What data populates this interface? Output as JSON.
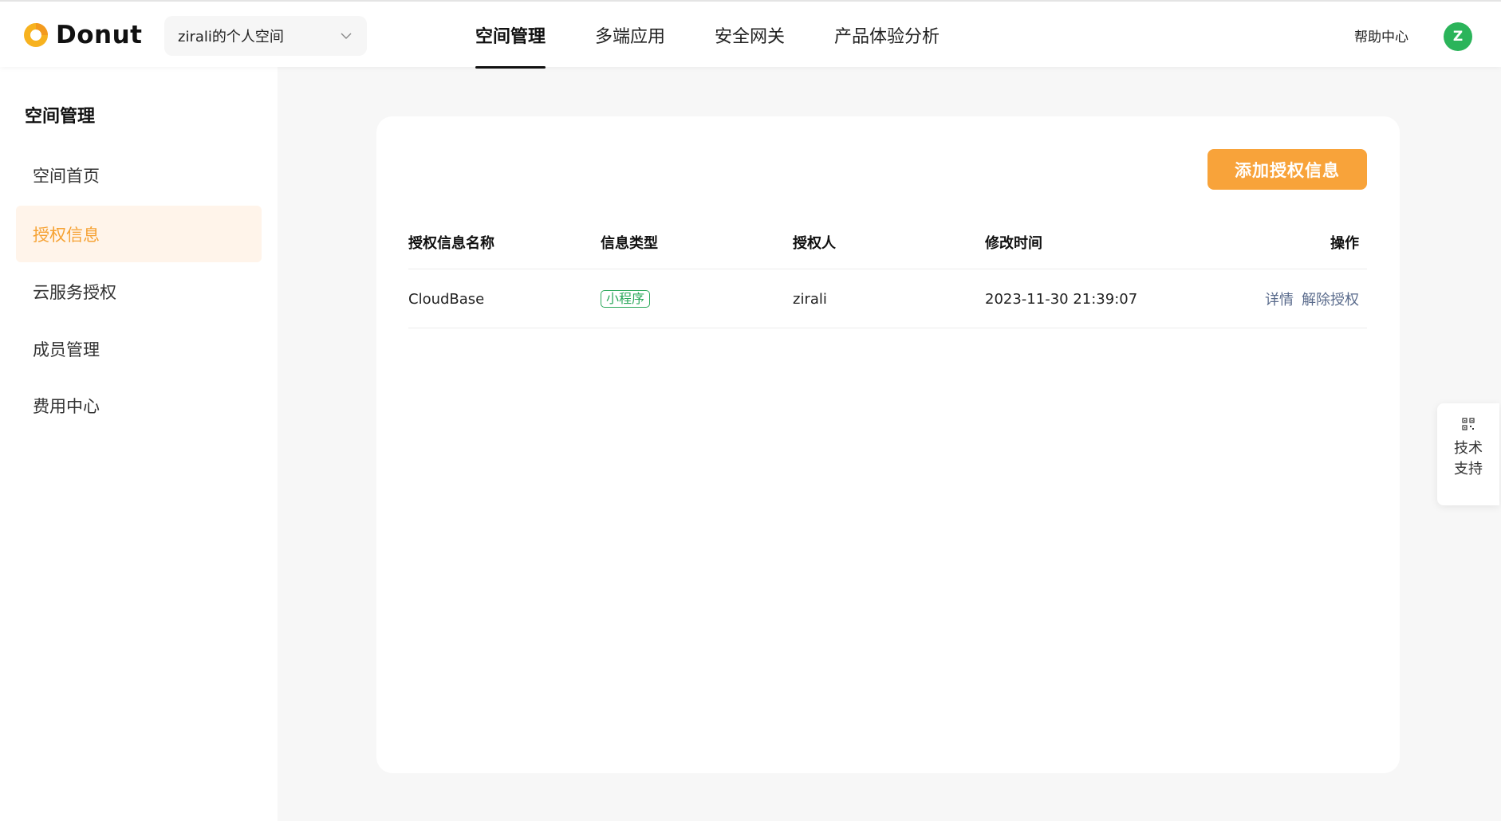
{
  "brand": {
    "name": "Donut",
    "logo_icon": "donut-logo-icon",
    "accent": "#f6a234"
  },
  "space_selector": {
    "value": "zirali的个人空间"
  },
  "nav": {
    "tabs": [
      {
        "label": "空间管理",
        "active": true
      },
      {
        "label": "多端应用",
        "active": false
      },
      {
        "label": "安全网关",
        "active": false
      },
      {
        "label": "产品体验分析",
        "active": false
      }
    ]
  },
  "header": {
    "help": "帮助中心",
    "avatar_letter": "Z",
    "avatar_color": "#2bb45a"
  },
  "sidebar": {
    "title": "空间管理",
    "items": [
      {
        "label": "空间首页",
        "active": false
      },
      {
        "label": "授权信息",
        "active": true
      },
      {
        "label": "云服务授权",
        "active": false
      },
      {
        "label": "成员管理",
        "active": false
      },
      {
        "label": "费用中心",
        "active": false
      }
    ]
  },
  "main": {
    "add_button": "添加授权信息",
    "table": {
      "columns": [
        "授权信息名称",
        "信息类型",
        "授权人",
        "修改时间",
        "操作"
      ],
      "rows": [
        {
          "name": "CloudBase",
          "type": "小程序",
          "authorizer": "zirali",
          "modified": "2023-11-30 21:39:07",
          "actions": [
            "详情",
            "解除授权"
          ]
        }
      ]
    }
  },
  "support": {
    "label": "技术支持",
    "icon": "qrcode-icon"
  }
}
